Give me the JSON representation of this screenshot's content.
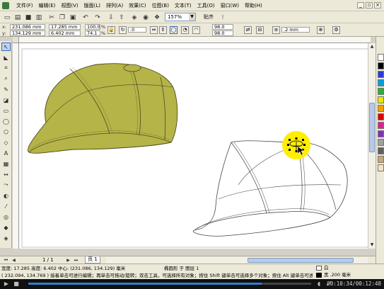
{
  "menu": {
    "items": [
      "文件(F)",
      "编辑(E)",
      "视图(V)",
      "版面(L)",
      "排列(A)",
      "效果(C)",
      "位图(B)",
      "文本(T)",
      "工具(O)",
      "窗口(W)",
      "帮助(H)"
    ]
  },
  "toolbar": {
    "zoom_value": "157%",
    "snap_label": "贴齐"
  },
  "property_bar": {
    "x_value": "231.086 mm",
    "y_value": "134.129 mm",
    "width_value": "17.285 mm",
    "height_value": "6.402 mm",
    "scale_x": "100.0",
    "scale_y": "74.1",
    "percent": "%",
    "rotation": ".0",
    "corner_a": "98.0",
    "corner_b": "98.0",
    "outline_width": ".2 mm"
  },
  "navigator": {
    "page_count": "1 / 1",
    "page_tab": "页 1"
  },
  "status": {
    "line1": "宽度: 17.285  高度: 6.402  中心: (231.086, 134.129)  毫米",
    "object_info": "椭圆形 于 图层 1",
    "line2": "( 232.094, 134.769 )    接着单击可进行编辑；再单击可拖动/旋转；双击工具，可选择所有对象；按住 Shift 键单击可选择多个对象；按住 Alt 键单击可进",
    "fill_label": "白",
    "outline_label": "黑  .200 毫米"
  },
  "player": {
    "time": "00:10:34/00:12:48",
    "progress": 0.826
  },
  "colors": {
    "hat_fill": "#b4b448",
    "highlight": "#ffee00",
    "accent": "#316ac5"
  },
  "palette": [
    "#ffffff",
    "#000000",
    "#2d3bd6",
    "#00a0e0",
    "#30b030",
    "#e8e800",
    "#f0a000",
    "#e00000",
    "#e02090",
    "#8030c0",
    "#a0a0a0",
    "#606060",
    "#c8a878",
    "#f4e4c4"
  ]
}
